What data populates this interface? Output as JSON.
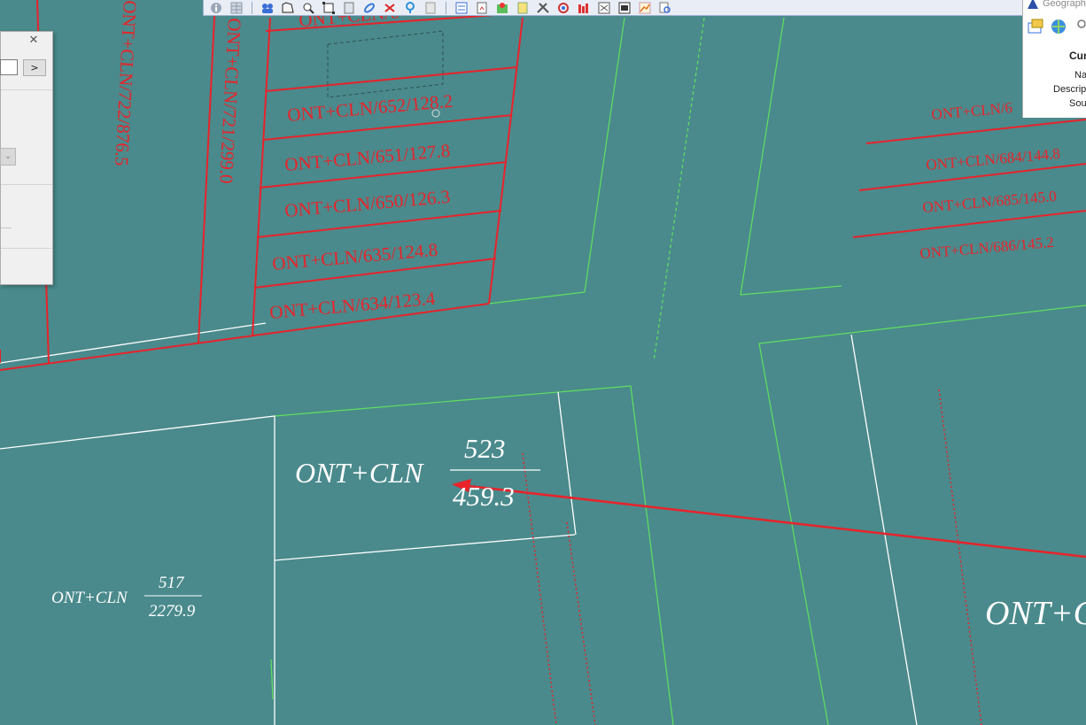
{
  "map": {
    "parcels_red": [
      "ONT+CLN/652/128.2",
      "ONT+CLN/651/127.8",
      "ONT+CLN/650/126.3",
      "ONT+CLN/635/124.8",
      "ONT+CLN/634/123.4"
    ],
    "parcels_red_vertical": [
      "ONT+CLN/722/876.5",
      "ONT+CLN/721/299.0"
    ],
    "parcels_red_right": [
      "ONT+CLN/6",
      "ONT+CLN/684/144.8",
      "ONT+CLN/685/145.0",
      "ONT+CLN/686/145.2"
    ],
    "top_partial_label": "ONT+CLN/6",
    "parcel_523": {
      "land_type": "ONT+CLN",
      "number": "523",
      "area": "459.3"
    },
    "parcel_517": {
      "land_type": "ONT+CLN",
      "number": "517",
      "area": "2279.9"
    },
    "partial_right_label": "ONT+C",
    "colors": {
      "background": "#4a8a8c",
      "parcel_red": "#e8232a",
      "boundary_green": "#5fe05f",
      "boundary_white": "#ffffff"
    }
  },
  "toolbar": {
    "icons": [
      "info-icon",
      "table-icon",
      "users-icon",
      "select-feature-icon",
      "zoom-icon",
      "full-extent-icon",
      "book-icon",
      "link-icon",
      "clear-selection-icon",
      "pin-icon",
      "layer-icon",
      "list-icon",
      "export-icon",
      "map-globe-icon",
      "layers-icon",
      "tools-icon",
      "target-icon",
      "chart-bars-icon",
      "swap-icon",
      "window-icon",
      "line-chart-icon",
      "search-icon"
    ]
  },
  "dialog": {
    "close_label": "✕",
    "go_label": ">"
  },
  "right_panel": {
    "title": "Geograph",
    "heading": "Cur",
    "fields": [
      "Na",
      "Descript",
      "Sou"
    ]
  }
}
